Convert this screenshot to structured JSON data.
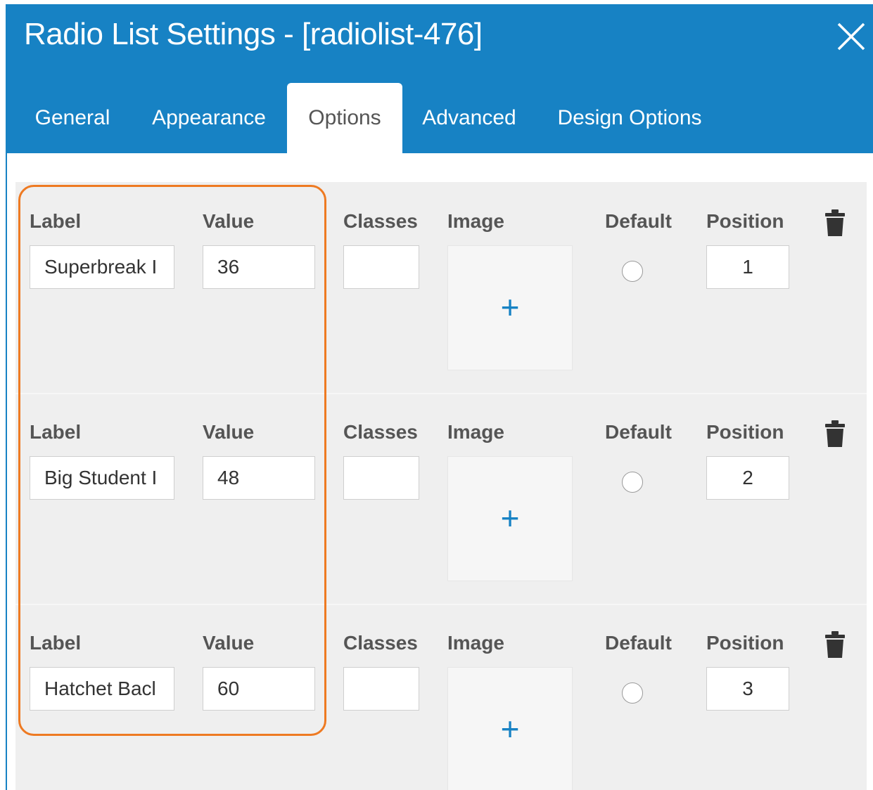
{
  "dialog": {
    "title": "Radio List Settings - [radiolist-476]",
    "close_icon": "close-icon",
    "accent_color": "#1782c4"
  },
  "tabs": [
    {
      "label": "General",
      "active": false
    },
    {
      "label": "Appearance",
      "active": false
    },
    {
      "label": "Options",
      "active": true
    },
    {
      "label": "Advanced",
      "active": false
    },
    {
      "label": "Design Options",
      "active": false
    }
  ],
  "columns": {
    "label": "Label",
    "value": "Value",
    "classes": "Classes",
    "image": "Image",
    "default": "Default",
    "position": "Position"
  },
  "options": [
    {
      "label": "Superbreak I",
      "value": "36",
      "classes": "",
      "default": false,
      "position": "1"
    },
    {
      "label": "Big Student I",
      "value": "48",
      "classes": "",
      "default": false,
      "position": "2"
    },
    {
      "label": "Hatchet Bacl",
      "value": "60",
      "classes": "",
      "default": false,
      "position": "3"
    }
  ],
  "image_add_symbol": "+",
  "delete_icon": "trash-icon",
  "highlight_color": "#ee7a22"
}
